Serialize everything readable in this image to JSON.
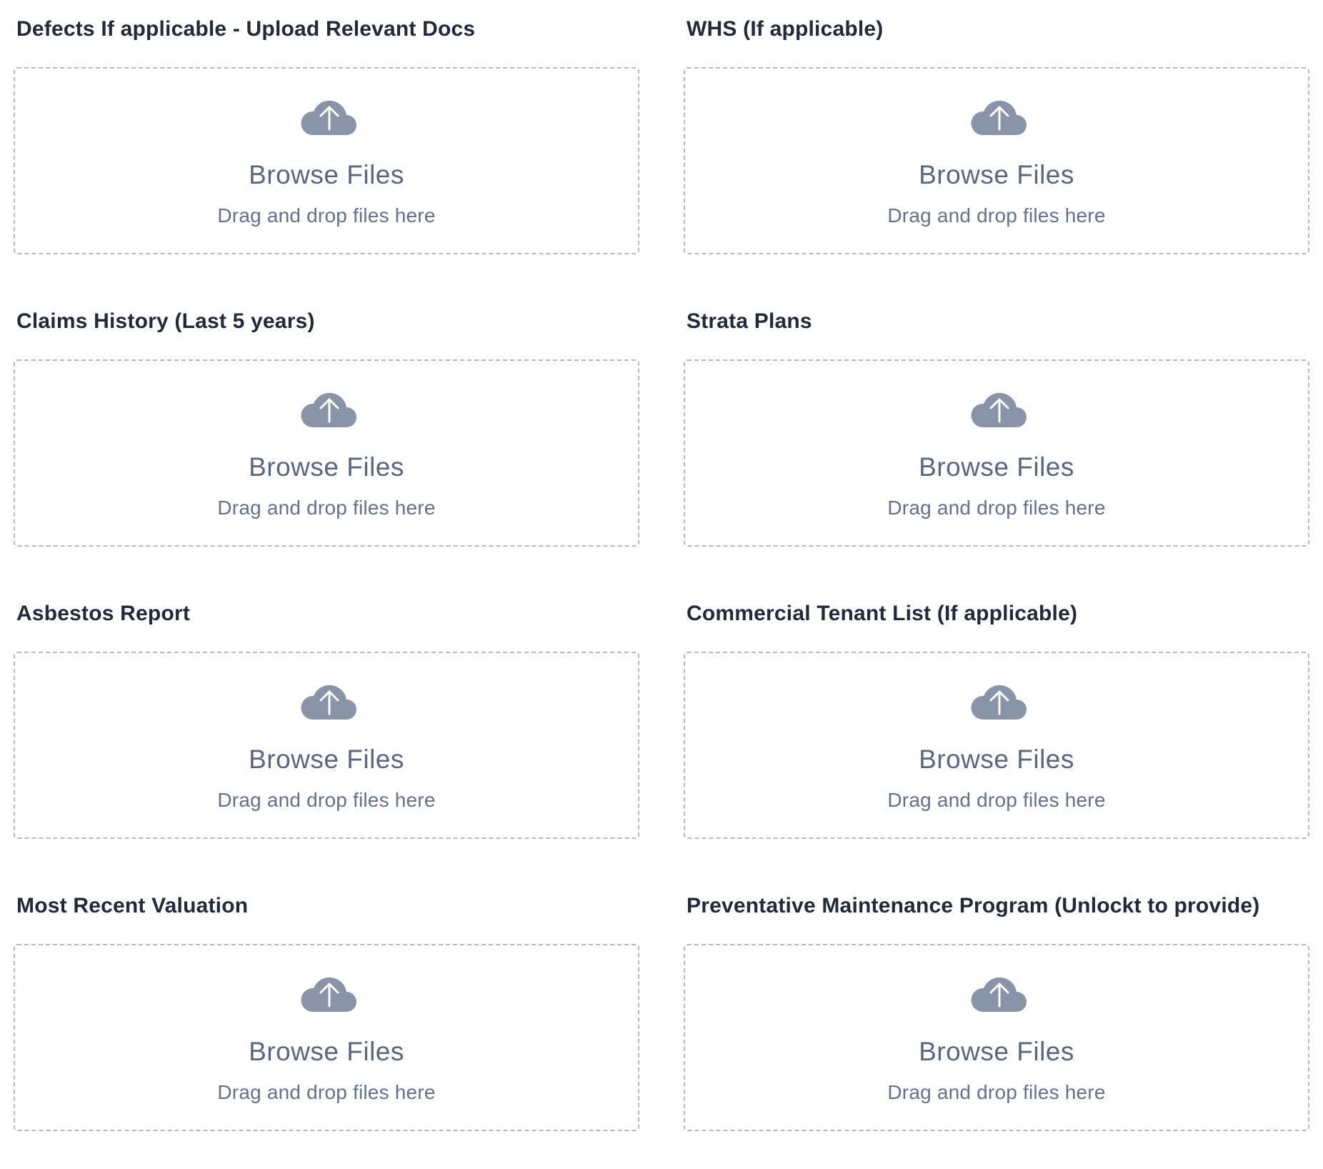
{
  "colors": {
    "label": "#222938",
    "icon": "#8a94a8",
    "browse_text": "#5a6680",
    "hint_text": "#65708a",
    "dropzone_border": "#b5b8be"
  },
  "upload_fields": [
    {
      "label": "Defects If applicable - Upload Relevant Docs",
      "browse": "Browse Files",
      "hint": "Drag and drop files here",
      "icon": "cloud-upload-icon"
    },
    {
      "label": "WHS (If applicable)",
      "browse": "Browse Files",
      "hint": "Drag and drop files here",
      "icon": "cloud-upload-icon"
    },
    {
      "label": "Claims History (Last 5 years)",
      "browse": "Browse Files",
      "hint": "Drag and drop files here",
      "icon": "cloud-upload-icon"
    },
    {
      "label": "Strata Plans",
      "browse": "Browse Files",
      "hint": "Drag and drop files here",
      "icon": "cloud-upload-icon"
    },
    {
      "label": "Asbestos Report",
      "browse": "Browse Files",
      "hint": "Drag and drop files here",
      "icon": "cloud-upload-icon"
    },
    {
      "label": "Commercial Tenant List (If applicable)",
      "browse": "Browse Files",
      "hint": "Drag and drop files here",
      "icon": "cloud-upload-icon"
    },
    {
      "label": "Most Recent Valuation",
      "browse": "Browse Files",
      "hint": "Drag and drop files here",
      "icon": "cloud-upload-icon"
    },
    {
      "label": "Preventative Maintenance Program (Unlockt to provide)",
      "browse": "Browse Files",
      "hint": "Drag and drop files here",
      "icon": "cloud-upload-icon"
    }
  ]
}
